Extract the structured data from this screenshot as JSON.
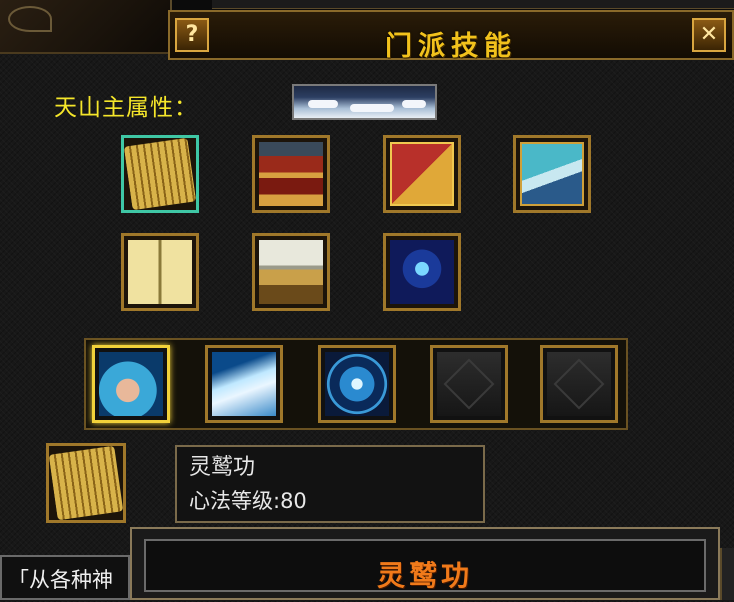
{
  "window": {
    "title": "门派技能"
  },
  "buttons": {
    "help": "?",
    "close": "✕"
  },
  "attribute": {
    "label": "天山主属性：",
    "banner_icon": "cloud-landscape-icon"
  },
  "books": [
    {
      "icon": "bamboo-scroll-icon",
      "selected": true
    },
    {
      "icon": "red-book-stack-icon"
    },
    {
      "icon": "golden-box-book-icon"
    },
    {
      "icon": "teal-book-icon"
    },
    {
      "icon": "open-scroll-icon"
    },
    {
      "icon": "white-scroll-stack-icon"
    },
    {
      "icon": "blue-spirit-scroll-icon"
    }
  ],
  "skills": [
    {
      "icon": "fist-skill-icon",
      "active": true
    },
    {
      "icon": "ice-blast-skill-icon"
    },
    {
      "icon": "meditation-aura-skill-icon"
    },
    {
      "icon": "locked-slot-icon",
      "locked": true
    },
    {
      "icon": "locked-slot-icon",
      "locked": true
    }
  ],
  "info": {
    "icon": "bamboo-scroll-icon",
    "name": "灵鹫功",
    "level": "心法等级:80"
  },
  "tooltip": {
    "title": "灵鹫功"
  },
  "left_strip": {
    "text": "「从各种神"
  },
  "colors": {
    "title": "#f2c21c",
    "attr_label": "#f5e62a",
    "tooltip_title": "#f07a1a",
    "frame_gold": "#a0782a",
    "selected_teal": "#3fc7a5",
    "active_gold": "#f2d23a"
  }
}
